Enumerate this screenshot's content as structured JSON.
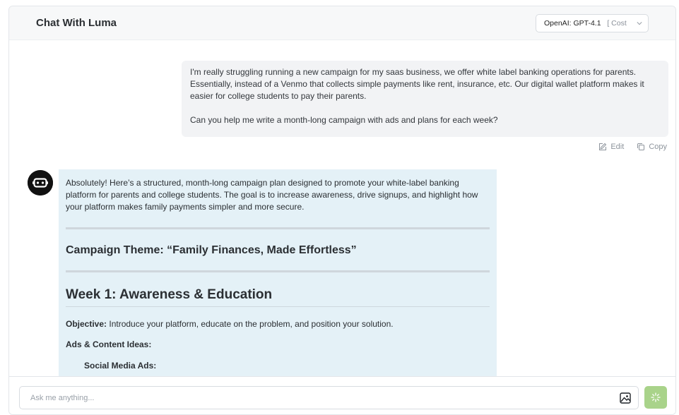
{
  "header": {
    "title": "Chat With Luma",
    "model_select": {
      "selected": "OpenAI: GPT-4.1",
      "extra": "[ Cost"
    }
  },
  "user_message": {
    "paragraphs": [
      "I'm really struggling running a new campaign for my saas business, we offer white label banking operations for parents. Essentially, instead of a Venmo that collects simple payments like rent, insurance, etc. Our digital wallet platform makes it easier for college students to pay their parents.",
      "Can you help me write a month-long campaign with ads and plans for each week?"
    ],
    "actions": {
      "edit": "Edit",
      "copy": "Copy"
    }
  },
  "assistant_message": {
    "intro": "Absolutely! Here’s a structured, month-long campaign plan designed to promote your white-label banking platform for parents and college students. The goal is to increase awareness, drive signups, and highlight how your platform makes family payments simpler and more secure.",
    "campaign_theme": "Campaign Theme: “Family Finances, Made Effortless”",
    "week_title": "Week 1: Awareness & Education",
    "objective_label": "Objective:",
    "objective_text": " Introduce your platform, educate on the problem, and position your solution.",
    "ads_label": "Ads & Content Ideas:",
    "social_ads": "Social Media Ads:"
  },
  "composer": {
    "placeholder": "Ask me anything..."
  },
  "icons": {
    "avatar": "robot-icon",
    "edit": "edit-icon",
    "copy": "copy-icon",
    "image": "image-icon",
    "send": "sparkle-icon",
    "chevron": "chevron-down-icon"
  },
  "colors": {
    "assistant_bubble": "#e4f1f7",
    "user_bubble": "#f2f3f5",
    "send_button": "#a9d38a"
  }
}
